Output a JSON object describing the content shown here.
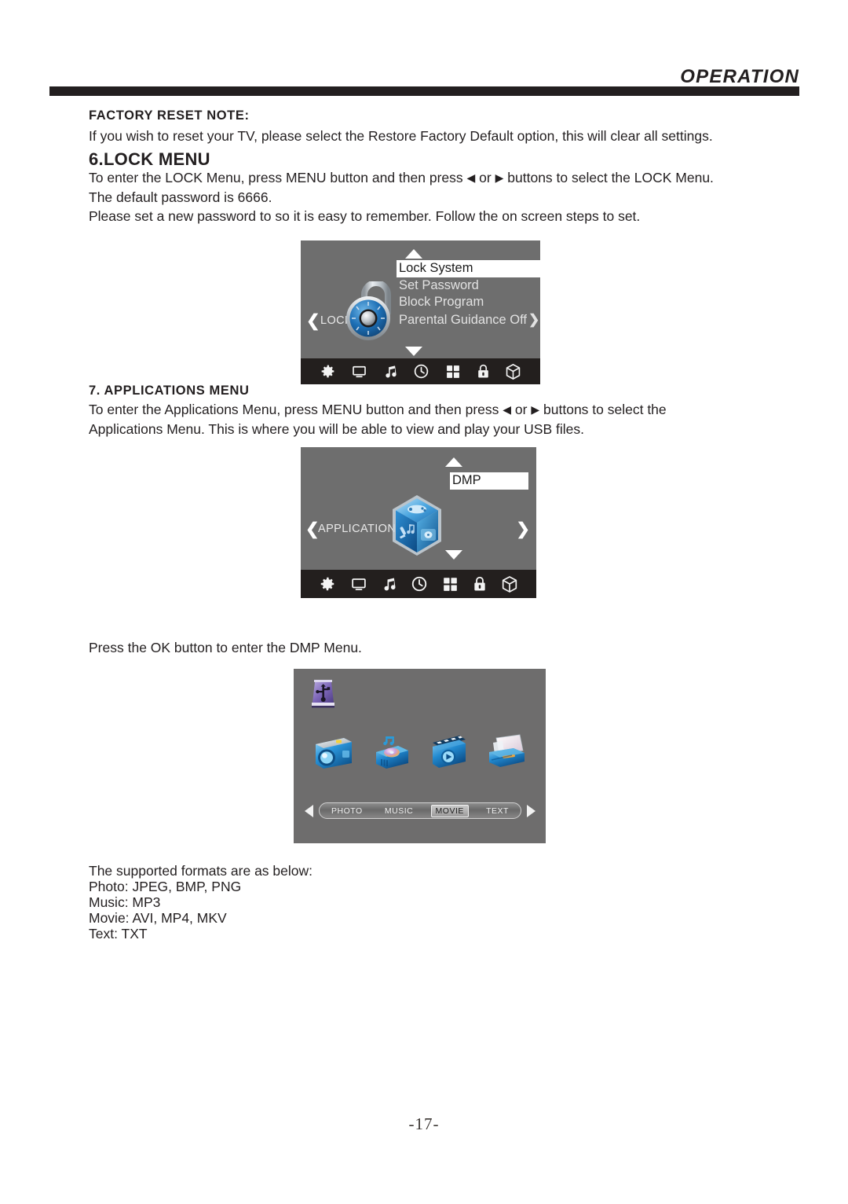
{
  "header": {
    "title": "OPERATION"
  },
  "factory_reset": {
    "title": "FACTORY RESET NOTE:",
    "body": "If you wish to reset your TV, please select the Restore Factory Default option, this will clear all settings."
  },
  "lock_section": {
    "heading": "6.LOCK MENU",
    "line1_a": "To enter the LOCK Menu, press MENU button and then press",
    "left_arrow": "◀",
    "or": "or",
    "right_arrow": "▶",
    "line1_b": "buttons to select the LOCK Menu.",
    "line2": "The default password is 6666.",
    "line3": "Please set a new password to so it is easy to remember. Follow the on screen steps to set."
  },
  "apps_section": {
    "heading": "7. APPLICATIONS MENU",
    "line1_a": "To enter the Applications Menu, press MENU button and then press",
    "left_arrow": "◀",
    "or": "or",
    "right_arrow": "▶",
    "line1_b": "buttons to select the",
    "line2": "Applications Menu. This is where you will be able to view and play your USB files."
  },
  "dmp_note": "Press the OK button to enter the DMP Menu.",
  "formats": {
    "intro": "The supported formats are as below:",
    "photo": "Photo: JPEG, BMP, PNG",
    "music": "Music: MP3",
    "movie": "Movie: AVI, MP4, MKV",
    "text": "Text: TXT"
  },
  "osd_lock": {
    "side_label": "LOCK",
    "left_chevron": "❮",
    "items": [
      {
        "label": "Lock System",
        "selected": true
      },
      {
        "label": "Set Password",
        "selected": false
      },
      {
        "label": "Block Program",
        "selected": false
      },
      {
        "label": "Parental Guidance Off",
        "selected": false,
        "chevron": "❯"
      }
    ],
    "bar_icons": [
      "gear-icon",
      "monitor-icon",
      "music-note-icon",
      "clock-icon",
      "grid-icon",
      "lock-icon",
      "cube-icon"
    ],
    "active_bar_icon": "lock-icon"
  },
  "osd_apps": {
    "side_label": "APPLICATIONS",
    "left_chevron": "❮",
    "right_chevron": "❯",
    "items": [
      {
        "label": "DMP",
        "selected": true
      }
    ],
    "bar_icons": [
      "gear-icon",
      "monitor-icon",
      "music-note-icon",
      "clock-icon",
      "grid-icon",
      "lock-icon",
      "cube-icon"
    ],
    "active_bar_icon": "cube-icon"
  },
  "osd_dmp": {
    "device_icon": "usb-drive-icon",
    "media_icons": [
      "camera-icon",
      "music-player-icon",
      "clapperboard-icon",
      "text-file-icon"
    ],
    "tabs": [
      {
        "label": "PHOTO",
        "active": false
      },
      {
        "label": "MUSIC",
        "active": false
      },
      {
        "label": "MOVIE",
        "active": true
      },
      {
        "label": "TEXT",
        "active": false
      }
    ]
  },
  "footer": {
    "page_number": "-17-"
  },
  "colors": {
    "ink": "#231f20",
    "osd_background": "#6e6e6e",
    "osd_bar": "#231f1e",
    "highlight": "#ffffff"
  }
}
